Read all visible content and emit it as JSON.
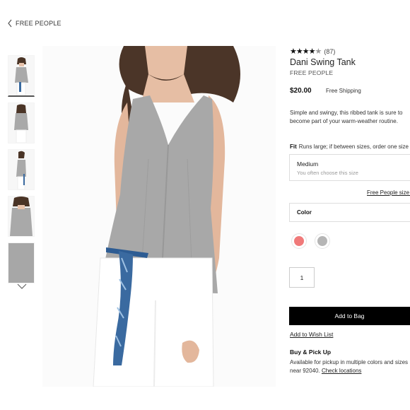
{
  "breadcrumb": {
    "label": "FREE PEOPLE"
  },
  "thumbnails": [
    {
      "name": "front-view"
    },
    {
      "name": "back-view"
    },
    {
      "name": "side-view"
    },
    {
      "name": "detail-view"
    },
    {
      "name": "fabric-swatch"
    }
  ],
  "product": {
    "rating_stars": "★★★★",
    "rating_half": "★",
    "rating_value": 4.5,
    "rating_count": "(87)",
    "title": "Dani Swing Tank",
    "brand": "FREE PEOPLE",
    "price": "$20.00",
    "shipping": "Free Shipping",
    "description": "Simple and swingy, this ribbed tank is sure to become part of your warm-weather routine."
  },
  "fit": {
    "label": "Fit",
    "text": "Runs large; if between sizes, order one size down."
  },
  "size": {
    "value": "Medium",
    "hint": "You often choose this size",
    "guide_link": "Free People size guide"
  },
  "color": {
    "label": "Color",
    "swatches": [
      {
        "name": "coral",
        "hex": "#f07a7a"
      },
      {
        "name": "heather-grey",
        "hex": "#b5b5b5"
      }
    ]
  },
  "quantity": {
    "value": "1"
  },
  "actions": {
    "add_to_bag": "Add to Bag",
    "wish_list": "Add to Wish List"
  },
  "pickup": {
    "heading": "Buy & Pick Up",
    "text": "Available for pickup in multiple colors and sizes near 92040.",
    "link": "Check locations"
  }
}
